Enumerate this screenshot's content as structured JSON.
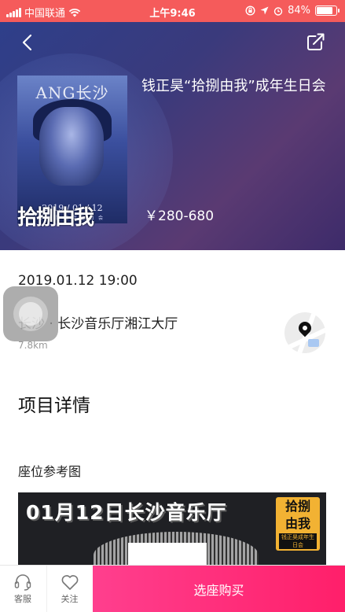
{
  "status_bar": {
    "carrier": "中国联通",
    "time": "上午9:46",
    "battery_percent": "84%",
    "battery_level": 0.84,
    "background_color": "#f55b5b"
  },
  "header": {
    "back_icon": "chevron-left-icon",
    "share_icon": "share-icon"
  },
  "event": {
    "poster": {
      "title_text": "ANG长沙 SHA",
      "date_text": "2019 / 01 / 12",
      "subtitle_text": "钱正昊成年生日会",
      "logo_text": "拾捌由我"
    },
    "title": "钱正昊“拾捌由我”成年生日会",
    "price": "￥280-680",
    "datetime": "2019.01.12 19:00",
    "venue": "长沙 · 长沙音乐厅湘江大厅",
    "distance": "7.8km",
    "map_icon": "map-pin-icon"
  },
  "details": {
    "section_title": "项目详情",
    "seat_label": "座位参考图",
    "seat_map_banner": "01月12日长沙音乐厅",
    "seat_map_logo_line1": "拾捌",
    "seat_map_logo_line2": "由我",
    "seat_map_logo_line3": "钱正昊成年生日会"
  },
  "bottom_bar": {
    "service_label": "客服",
    "service_icon": "headset-icon",
    "follow_label": "关注",
    "follow_icon": "heart-icon",
    "buy_label": "选座购买",
    "buy_color": "#ff2a75"
  }
}
